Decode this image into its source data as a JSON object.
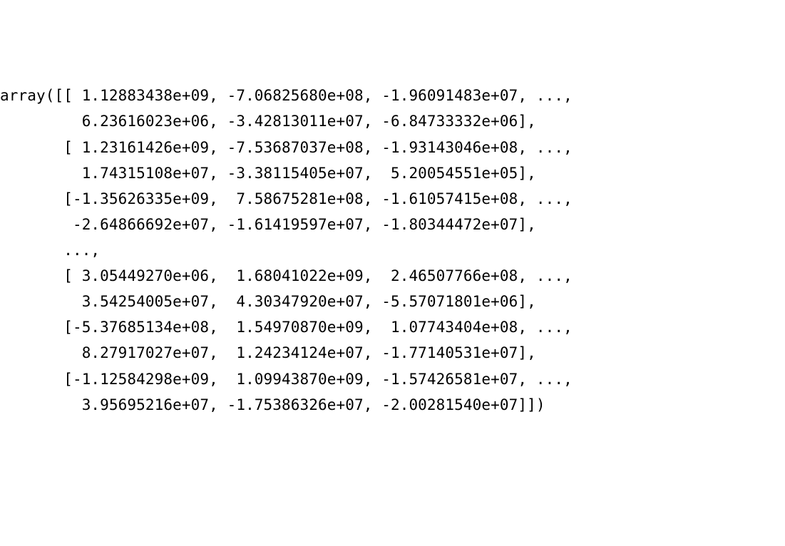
{
  "array_repr": {
    "lines": [
      "array([[ 1.12883438e+09, -7.06825680e+08, -1.96091483e+07, ...,",
      "         6.23616023e+06, -3.42813011e+07, -6.84733332e+06],",
      "       [ 1.23161426e+09, -7.53687037e+08, -1.93143046e+08, ...,",
      "         1.74315108e+07, -3.38115405e+07,  5.20054551e+05],",
      "       [-1.35626335e+09,  7.58675281e+08, -1.61057415e+08, ...,",
      "        -2.64866692e+07, -1.61419597e+07, -1.80344472e+07],",
      "       ...,",
      "       [ 3.05449270e+06,  1.68041022e+09,  2.46507766e+08, ...,",
      "         3.54254005e+07,  4.30347920e+07, -5.57071801e+06],",
      "       [-5.37685134e+08,  1.54970870e+09,  1.07743404e+08, ...,",
      "         8.27917027e+07,  1.24234124e+07, -1.77140531e+07],",
      "       [-1.12584298e+09,  1.09943870e+09, -1.57426581e+07, ...,",
      "         3.95695216e+07, -1.75386326e+07, -2.00281540e+07]])"
    ]
  },
  "chart_data": {
    "type": "table",
    "title": "NumPy array repr (truncated)",
    "rows": [
      {
        "head": [
          1128834380.0,
          -706825680.0,
          -19609148.3
        ],
        "tail": [
          6236160.23,
          -34281301.1,
          -6847333.32
        ]
      },
      {
        "head": [
          1231614260.0,
          -753687037.0,
          -193143046.0
        ],
        "tail": [
          17431510.8,
          -33811540.5,
          520054.551
        ]
      },
      {
        "head": [
          -1356263350.0,
          758675281.0,
          -161057415.0
        ],
        "tail": [
          -26486669.2,
          -16141959.7,
          -18034447.2
        ]
      },
      {
        "ellipsis": true
      },
      {
        "head": [
          3054492.7,
          1680410220.0,
          246507766.0
        ],
        "tail": [
          35425400.5,
          43034792.0,
          -5570718.01
        ]
      },
      {
        "head": [
          -537685134.0,
          1549708700.0,
          107743404.0
        ],
        "tail": [
          82791702.7,
          12423412.4,
          -17714053.1
        ]
      },
      {
        "head": [
          -1125842980.0,
          1099438700.0,
          -15742658.1
        ],
        "tail": [
          39569521.6,
          -17538632.6,
          -20028154.0
        ]
      }
    ]
  }
}
